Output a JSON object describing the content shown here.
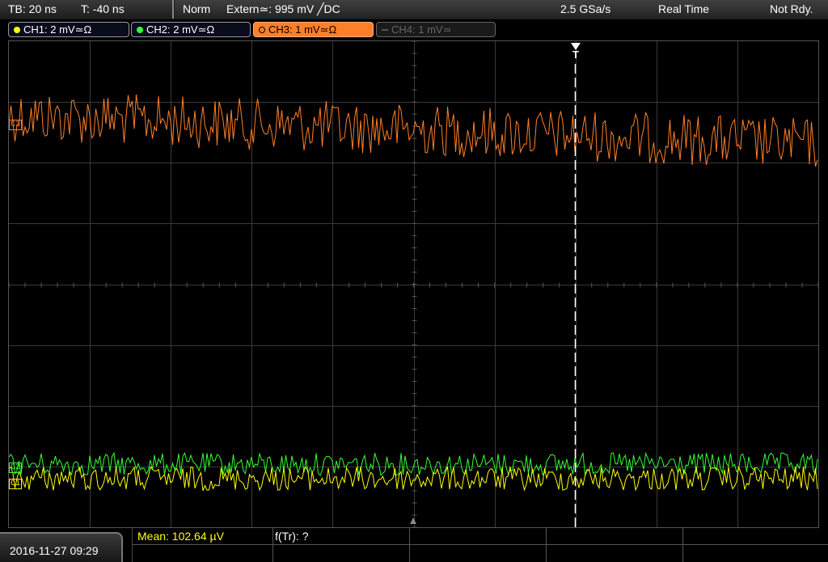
{
  "status": {
    "timebase": "TB: 20 ns",
    "trigger_time": "T: -40 ns",
    "mode": "Norm",
    "trigger_source": "Extern≃: 995 mV ╱DC",
    "sample_rate": "2.5 GSa/s",
    "acq_mode": "Real Time",
    "state": "Not Rdy."
  },
  "channels": [
    {
      "label": "CH1: 2 mV≃Ω",
      "color": "#ffff00",
      "active": true
    },
    {
      "label": "CH2: 2 mV≃Ω",
      "color": "#33ff33",
      "active": true
    },
    {
      "label": "CH3: 1 mV≃Ω",
      "color": "#ff7f27",
      "active": true,
      "selected": true
    },
    {
      "label": "CH4: 1 mV≃",
      "color": "#666666",
      "active": false
    }
  ],
  "trigger_marker": "T",
  "datetime": "2016-11-27  09:29",
  "measurements": {
    "mean": "Mean: 102.64 µV",
    "frequency": "f(Tr): ?"
  },
  "markers": {
    "ch3": "C3",
    "ch2": "C2",
    "ch1": "C1"
  },
  "colors": {
    "ch1": "#ffff00",
    "ch2": "#33ff33",
    "ch3": "#ff7f27",
    "grid": "#3a3a3a",
    "trigger_line": "#ffffff"
  }
}
